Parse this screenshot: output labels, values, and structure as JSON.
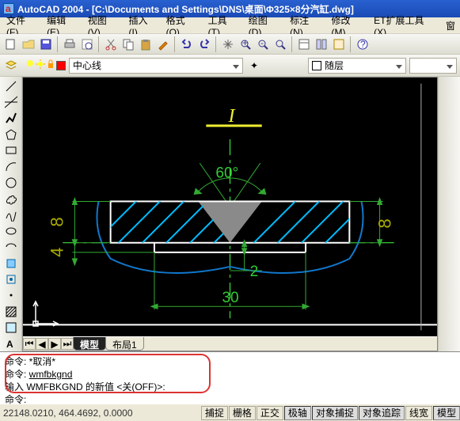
{
  "app": {
    "title": "AutoCAD 2004 - [C:\\Documents and Settings\\DNS\\桌面\\Φ325×8分汽缸.dwg]"
  },
  "menu": {
    "file": "文件(F)",
    "edit": "编辑(E)",
    "view": "视图(V)",
    "insert": "插入(I)",
    "format": "格式(O)",
    "tools": "工具(T)",
    "draw": "绘图(D)",
    "dimension": "标注(N)",
    "modify": "修改(M)",
    "et": "ET扩展工具(X)",
    "window": "窗"
  },
  "layerbar": {
    "current_layer": "中心线"
  },
  "propbar": {
    "color_label": "随层"
  },
  "tabs": {
    "model": "模型",
    "layout1": "布局1"
  },
  "cmd": {
    "line1": "命令: *取消*",
    "line2_prefix": "命令: ",
    "line2_cmd": "wmfbkgnd",
    "line3": "输入 WMFBKGND 的新值 <关(OFF)>:",
    "line4": "命令:"
  },
  "status": {
    "coords": "22148.0210, 464.4692, 0.0000",
    "snap": "捕捉",
    "grid": "栅格",
    "ortho": "正交",
    "polar": "极轴",
    "osnap": "对象捕捉",
    "otrack": "对象追踪",
    "lwt": "线宽",
    "model": "模型"
  },
  "drawing": {
    "annotation_I": "I",
    "angle": "60°",
    "dim8_left": "8",
    "dim4_left": "4",
    "dim8_right": "8",
    "dim2": "2",
    "dim30": "30"
  },
  "colors": {
    "title_start": "#2961d0",
    "title_end": "#1a4ab5",
    "panel": "#ece9d8",
    "swatches": [
      "#ffff00",
      "#00ff00",
      "#00ffff",
      "#ffffff",
      "#ff0000"
    ]
  }
}
